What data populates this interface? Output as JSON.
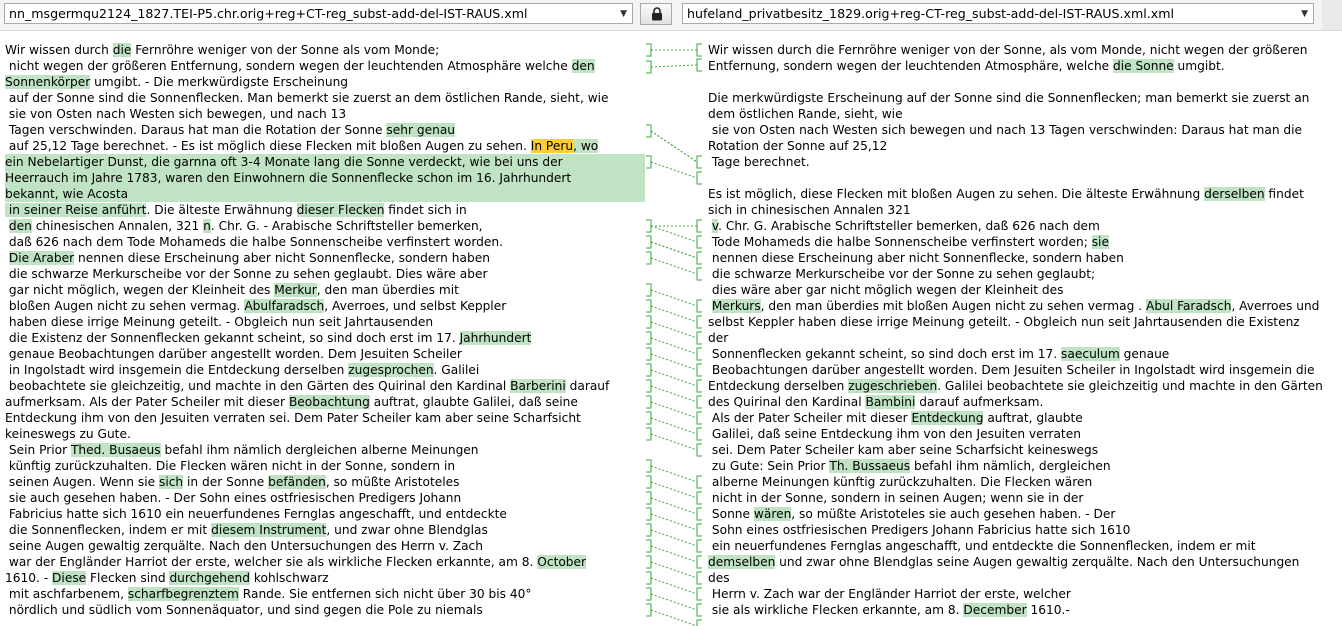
{
  "toolbar": {
    "left_file": "nn_msgermqu2124_1827.TEI-P5.chr.orig+reg+CT-reg_subst-add-del-IST-RAUS.xml",
    "right_file": "hufeland_privatbesitz_1829.orig+reg-CT-reg_subst-add-del-IST-RAUS.xml.xml"
  },
  "icons": {
    "lock": "lock-icon",
    "dropdown": "chevron-down-icon"
  },
  "colors": {
    "highlight": "#bfe3c3",
    "highlight_strong": "#ffcc33",
    "connector": "#3aa53a"
  },
  "left_lines": [
    [
      {
        "t": "Wir wissen durch "
      },
      {
        "t": "die",
        "h": 1
      },
      {
        "t": " Fernröhre weniger von der Sonne als vom Monde;"
      }
    ],
    [
      {
        "t": " nicht wegen der größeren Entfernung, sondern wegen der leuchtenden Atmosphäre welche "
      },
      {
        "t": "den",
        "h": 1
      }
    ],
    [
      {
        "t": "Sonnenkörper",
        "h": 1
      },
      {
        "t": " umgibt. - Die merkwürdigste Erscheinung"
      }
    ],
    [
      {
        "t": " auf der Sonne sind die Sonnenflecken. Man bemerkt sie zuerst an dem östlichen Rande, sieht, wie"
      }
    ],
    [
      {
        "t": " sie von Osten nach Westen sich bewegen, und nach 13"
      }
    ],
    [
      {
        "t": " Tagen verschwinden. Daraus hat man die Rotation der Sonne "
      },
      {
        "t": "sehr genau",
        "h": 1
      }
    ],
    [
      {
        "t": " auf 25,12 Tage berechnet. - Es ist möglich diese Flecken mit bloßen Augen zu sehen. "
      },
      {
        "t": "In Peru",
        "h": 2
      },
      {
        "t": ", wo",
        "h": 1
      }
    ],
    [
      {
        "t": "ein Nebelartiger Dunst, die garnna oft 3-4 Monate lang die Sonne verdeckt, wie bei uns der",
        "h": 1
      }
    ],
    [
      {
        "t": "Heerrauch im Jahre 1783, waren den Einwohnern die Sonnenflecke schon im 16. Jahrhundert",
        "h": 1
      }
    ],
    [
      {
        "t": "bekannt, wie Acosta",
        "h": 1
      }
    ],
    [
      {
        "t": " in seiner Reise anführt",
        "h": 1
      },
      {
        "t": ". Die älteste Erwähnung "
      },
      {
        "t": "dieser Flecken",
        "h": 1
      },
      {
        "t": " findet sich in"
      }
    ],
    [
      {
        "t": " "
      },
      {
        "t": "den",
        "h": 1
      },
      {
        "t": " chinesischen Annalen, 321 "
      },
      {
        "t": "n",
        "h": 1
      },
      {
        "t": ". Chr. G. - Arabische Schriftsteller bemerken,"
      }
    ],
    [
      {
        "t": " daß 626 nach dem Tode Mohameds die halbe Sonnenscheibe verfinstert worden."
      }
    ],
    [
      {
        "t": " "
      },
      {
        "t": "Die Araber",
        "h": 1
      },
      {
        "t": " nennen diese Erscheinung aber nicht Sonnenflecke, sondern haben"
      }
    ],
    [
      {
        "t": " die schwarze Merkurscheibe vor der Sonne zu sehen geglaubt. Dies wäre aber"
      }
    ],
    [
      {
        "t": " gar nicht möglich, wegen der Kleinheit des "
      },
      {
        "t": "Merkur",
        "h": 1
      },
      {
        "t": ", den man überdies mit"
      }
    ],
    [
      {
        "t": " bloßen Augen nicht zu sehen vermag. "
      },
      {
        "t": "Abulfaradsch",
        "h": 1
      },
      {
        "t": ", Averroes, und selbst Keppler"
      }
    ],
    [
      {
        "t": " haben diese irrige Meinung geteilt. - Obgleich nun seit Jahrtausenden"
      }
    ],
    [
      {
        "t": " die Existenz der Sonnenflecken gekannt scheint, so sind doch erst im 17. "
      },
      {
        "t": "Jahrhundert",
        "h": 1
      }
    ],
    [
      {
        "t": " genaue Beobachtungen darüber angestellt worden. Dem Jesuiten Scheiler"
      }
    ],
    [
      {
        "t": " in Ingolstadt wird insgemein die Entdeckung derselben "
      },
      {
        "t": "zugesprochen",
        "h": 1
      },
      {
        "t": ". Galilei"
      }
    ],
    [
      {
        "t": " beobachtete sie gleichzeitig, und machte in den Gärten des Quirinal den Kardinal "
      },
      {
        "t": "Barberini",
        "h": 1
      },
      {
        "t": " darauf"
      }
    ],
    [
      {
        "t": "aufmerksam. Als der Pater Scheiler mit dieser "
      },
      {
        "t": "Beobachtung",
        "h": 1
      },
      {
        "t": " auftrat, glaubte Galilei, daß seine"
      }
    ],
    [
      {
        "t": "Entdeckung ihm von den Jesuiten verraten sei. Dem Pater Scheiler kam aber seine Scharfsicht"
      }
    ],
    [
      {
        "t": "keineswegs zu Gute."
      }
    ],
    [
      {
        "t": " Sein Prior "
      },
      {
        "t": "Thed. Busaeus",
        "h": 1
      },
      {
        "t": " befahl ihm nämlich dergleichen alberne Meinungen"
      }
    ],
    [
      {
        "t": " künftig zurückzuhalten. Die Flecken wären nicht in der Sonne, sondern in"
      }
    ],
    [
      {
        "t": " seinen Augen. Wenn sie "
      },
      {
        "t": "sich",
        "h": 1
      },
      {
        "t": " in der Sonne "
      },
      {
        "t": "befänden",
        "h": 1
      },
      {
        "t": ", so müßte Aristoteles"
      }
    ],
    [
      {
        "t": " sie auch gesehen haben. - Der Sohn eines ostfriesischen Predigers Johann"
      }
    ],
    [
      {
        "t": " Fabricius hatte sich 1610 ein neuerfundenes Fernglas angeschafft, und entdeckte"
      }
    ],
    [
      {
        "t": " die Sonnenflecken, indem er mit "
      },
      {
        "t": "diesem Instrument",
        "h": 1
      },
      {
        "t": ", und zwar ohne Blendglas"
      }
    ],
    [
      {
        "t": " seine Augen gewaltig zerquälte. Nach den Untersuchungen des Herrn v. Zach"
      }
    ],
    [
      {
        "t": " war der Engländer Harriot der erste, welcher sie als wirkliche Flecken erkannte, am 8. "
      },
      {
        "t": "October",
        "h": 1
      }
    ],
    [
      {
        "t": "1610. - "
      },
      {
        "t": "Diese",
        "h": 1
      },
      {
        "t": " Flecken sind "
      },
      {
        "t": "durchgehend",
        "h": 1
      },
      {
        "t": " kohlschwarz"
      }
    ],
    [
      {
        "t": " mit aschfarbenem, "
      },
      {
        "t": "scharfbegrenztem",
        "h": 1
      },
      {
        "t": " Rande. Sie entfernen sich nicht über 30 bis 40°"
      }
    ],
    [
      {
        "t": " nördlich und südlich vom Sonnenäquator, und sind gegen die Pole zu niemals"
      }
    ]
  ],
  "right_lines": [
    [
      {
        "t": "Wir wissen durch die Fernröhre weniger von der Sonne, als vom Monde, nicht wegen der größeren"
      }
    ],
    [
      {
        "t": "Entfernung, sondern wegen der leuchtenden Atmosphäre, welche "
      },
      {
        "t": "die Sonne",
        "h": 1
      },
      {
        "t": " umgibt."
      }
    ],
    [
      {
        "t": ""
      }
    ],
    [
      {
        "t": "Die merkwürdigste Erscheinung auf der Sonne sind die Sonnenflecken; man bemerkt sie zuerst an"
      }
    ],
    [
      {
        "t": "dem östlichen Rande, sieht, wie"
      }
    ],
    [
      {
        "t": " sie von Osten nach Westen sich bewegen und nach 13 Tagen verschwinden: Daraus hat man die"
      }
    ],
    [
      {
        "t": "Rotation der Sonne auf 25,12"
      }
    ],
    [
      {
        "t": " Tage berechnet."
      }
    ],
    [
      {
        "t": ""
      }
    ],
    [
      {
        "t": "Es ist möglich, diese Flecken mit bloßen Augen zu sehen. Die älteste Erwähnung "
      },
      {
        "t": "derselben",
        "h": 1
      },
      {
        "t": " findet"
      }
    ],
    [
      {
        "t": "sich in chinesischen Annalen 321"
      }
    ],
    [
      {
        "t": " "
      },
      {
        "t": "v",
        "h": 1
      },
      {
        "t": ". Chr. G. Arabische Schriftsteller bemerken, daß 626 nach dem"
      }
    ],
    [
      {
        "t": " Tode Mohameds die halbe Sonnenscheibe verfinstert worden; "
      },
      {
        "t": "sie",
        "h": 1
      }
    ],
    [
      {
        "t": " nennen diese Erscheinung aber nicht Sonnenflecke, sondern haben"
      }
    ],
    [
      {
        "t": " die schwarze Merkurscheibe vor der Sonne zu sehen geglaubt;"
      }
    ],
    [
      {
        "t": " dies wäre aber gar nicht möglich wegen der Kleinheit des"
      }
    ],
    [
      {
        "t": " "
      },
      {
        "t": "Merkurs",
        "h": 1
      },
      {
        "t": ", den man überdies mit bloßen Augen nicht zu sehen vermag . "
      },
      {
        "t": "Abul Faradsch",
        "h": 1
      },
      {
        "t": ", Averroes und"
      }
    ],
    [
      {
        "t": "selbst Keppler haben diese irrige Meinung geteilt. - Obgleich nun seit Jahrtausenden die Existenz"
      }
    ],
    [
      {
        "t": "der"
      }
    ],
    [
      {
        "t": " Sonnenflecken gekannt scheint, so sind doch erst im 17. "
      },
      {
        "t": "saeculum",
        "h": 1
      },
      {
        "t": " genaue"
      }
    ],
    [
      {
        "t": " Beobachtungen darüber angestellt worden. Dem Jesuiten Scheiler in Ingolstadt wird insgemein die"
      }
    ],
    [
      {
        "t": "Entdeckung derselben "
      },
      {
        "t": "zugeschrieben",
        "h": 1
      },
      {
        "t": ". Galilei beobachtete sie gleichzeitig und machte in den Gärten"
      }
    ],
    [
      {
        "t": "des Quirinal den Kardinal "
      },
      {
        "t": "Bambini",
        "h": 1
      },
      {
        "t": " darauf aufmerksam."
      }
    ],
    [
      {
        "t": " Als der Pater Scheiler mit dieser "
      },
      {
        "t": "Entdeckung",
        "h": 1
      },
      {
        "t": " auftrat, glaubte"
      }
    ],
    [
      {
        "t": " Galilei, daß seine Entdeckung ihm von den Jesuiten verraten"
      }
    ],
    [
      {
        "t": " sei. Dem Pater Scheiler kam aber seine Scharfsicht keineswegs"
      }
    ],
    [
      {
        "t": " zu Gute: Sein Prior "
      },
      {
        "t": "Th. Bussaeus",
        "h": 1
      },
      {
        "t": " befahl ihm nämlich, dergleichen"
      }
    ],
    [
      {
        "t": " alberne Meinungen künftig zurückzuhalten. Die Flecken wären"
      }
    ],
    [
      {
        "t": " nicht in der Sonne, sondern in seinen Augen; wenn sie in der"
      }
    ],
    [
      {
        "t": " Sonne "
      },
      {
        "t": "wären",
        "h": 1
      },
      {
        "t": ", so müßte Aristoteles sie auch gesehen haben. - Der"
      }
    ],
    [
      {
        "t": " Sohn eines ostfriesischen Predigers Johann Fabricius hatte sich 1610"
      }
    ],
    [
      {
        "t": " ein neuerfundenes Fernglas angeschafft, und entdeckte die Sonnenflecken, indem er mit"
      }
    ],
    [
      {
        "t": "demselben",
        "h": 1
      },
      {
        "t": " und zwar ohne Blendglas seine Augen gewaltig zerquälte. Nach den Untersuchungen"
      }
    ],
    [
      {
        "t": "des"
      }
    ],
    [
      {
        "t": " Herrn v. Zach war der Engländer Harriot der erste, welcher"
      }
    ],
    [
      {
        "t": " sie als wirkliche Flecken erkannte, am 8. "
      },
      {
        "t": "December",
        "h": 1
      },
      {
        "t": " 1610.-"
      }
    ]
  ]
}
